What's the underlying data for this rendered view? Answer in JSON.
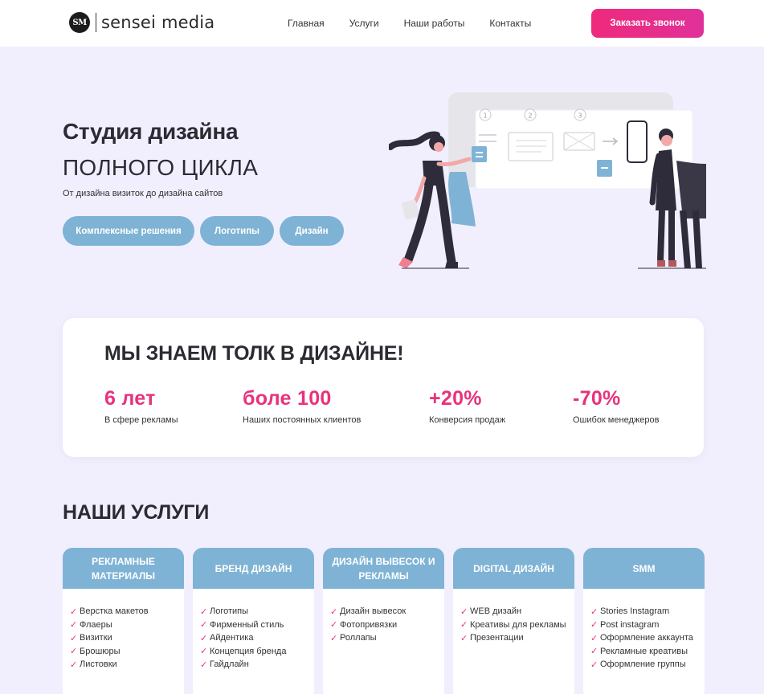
{
  "header": {
    "logo_badge": "SM",
    "logo_text": "sensei media",
    "nav": [
      "Главная",
      "Услуги",
      "Наши работы",
      "Контакты"
    ],
    "cta_label": "Заказать звонок"
  },
  "hero": {
    "title": "Студия дизайна",
    "subtitle": "ПОЛНОГО ЦИКЛА",
    "description": "От дизайна визиток до дизайна сайтов",
    "pills": [
      "Комплексные решения",
      "Логотипы",
      "Дизайн"
    ],
    "steps": [
      "1",
      "2",
      "3"
    ]
  },
  "stats": {
    "title": "МЫ ЗНАЕМ ТОЛК В ДИЗАЙНЕ!",
    "items": [
      {
        "value": "6 лет",
        "label": "В сфере рекламы"
      },
      {
        "value": "боле 100",
        "label": "Наших постоянных клиентов"
      },
      {
        "value": "+20%",
        "label": "Конверсия продаж"
      },
      {
        "value": "-70%",
        "label": "Ошибок менеджеров"
      }
    ]
  },
  "services": {
    "title": "НАШИ УСЛУГИ",
    "cards": [
      {
        "title": "РЕКЛАМНЫЕ МАТЕРИАЛЫ",
        "items": [
          "Верстка макетов",
          "Флаеры",
          "Визитки",
          "Брошюры",
          "Листовки"
        ]
      },
      {
        "title": "БРЕНД ДИЗАЙН",
        "items": [
          "Логотипы",
          "Фирменный стиль",
          "Айдентика",
          "Концепция бренда",
          "Гайдлайн"
        ]
      },
      {
        "title": "ДИЗАЙН ВЫВЕСОК И РЕКЛАМЫ",
        "items": [
          "Дизайн вывесок",
          "Фотопривязки",
          "Роллапы"
        ]
      },
      {
        "title": "DIGITAL ДИЗАЙН",
        "items": [
          "WEB дизайн",
          "Креативы для рекламы",
          "Презентации"
        ]
      },
      {
        "title": "SMM",
        "items": [
          "Stories Instagram",
          "Post instagram",
          "Оформление аккаунта",
          "Рекламные креативы",
          "Оформление группы"
        ]
      }
    ]
  },
  "colors": {
    "accent": "#e8327d",
    "pill": "#7fb3d5",
    "background": "#f1effd"
  }
}
